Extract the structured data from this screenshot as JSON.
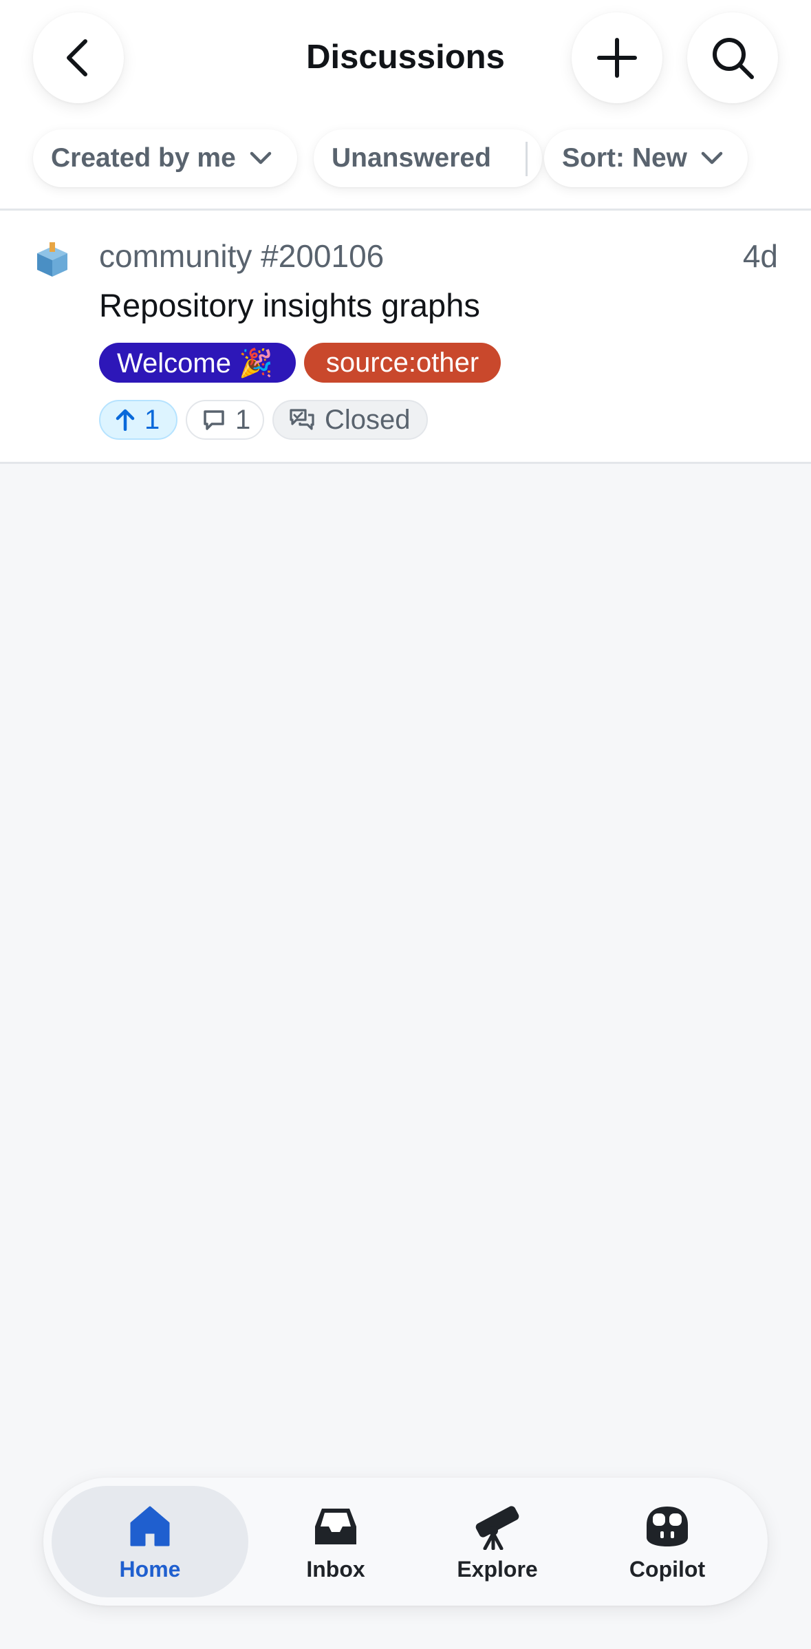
{
  "header": {
    "title": "Discussions",
    "back_icon": "chevron-left-icon",
    "add_icon": "plus-icon",
    "search_icon": "search-icon"
  },
  "filters": {
    "created_by": "Created by me",
    "unanswered": "Unanswered",
    "sort": "Sort: New"
  },
  "discussion": {
    "repo": "community #200106",
    "age": "4d",
    "title": "Repository insights graphs",
    "labels": [
      {
        "text": "Welcome 🎉",
        "color": "#2d17b8"
      },
      {
        "text": "source:other",
        "color": "#c9482c"
      }
    ],
    "upvotes": "1",
    "comments": "1",
    "state": "Closed"
  },
  "tabs": [
    {
      "label": "Home",
      "icon": "home-icon",
      "active": true
    },
    {
      "label": "Inbox",
      "icon": "inbox-icon",
      "active": false
    },
    {
      "label": "Explore",
      "icon": "telescope-icon",
      "active": false
    },
    {
      "label": "Copilot",
      "icon": "copilot-icon",
      "active": false
    }
  ],
  "colors": {
    "accent": "#1f5fcf",
    "upvote": "#0969da",
    "background": "#f6f7f9"
  }
}
